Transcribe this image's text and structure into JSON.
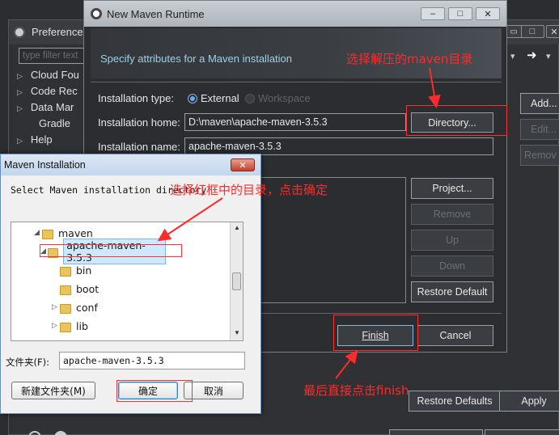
{
  "preferences": {
    "title": "Preferences",
    "filter_placeholder": "type filter text",
    "tree_items": [
      "Cloud Fou",
      "Code Rec",
      "Data Mar",
      "Gradle",
      "Help"
    ],
    "right_buttons": [
      "Add...",
      "Edit...",
      "Remov"
    ],
    "restore_defaults": "Restore Defaults",
    "apply": "Apply"
  },
  "runtime_dialog": {
    "title": "New Maven Runtime",
    "subtitle": "Specify attributes for a Maven installation",
    "installation_type_label": "Installation type:",
    "type_external": "External",
    "type_workspace": "Workspace",
    "installation_home_label": "Installation home:",
    "installation_home_value": "D:\\maven\\apache-maven-3.5.3",
    "directory_button": "Directory...",
    "installation_name_label": "Installation name:",
    "installation_name_value": "apache-maven-3.5.3",
    "side_buttons": {
      "project": "Project...",
      "remove": "Remove",
      "up": "Up",
      "down": "Down",
      "restore_default": "Restore Default"
    },
    "finish": "Finish",
    "cancel": "Cancel"
  },
  "maven_install_dialog": {
    "title": "Maven Installation",
    "prompt": "Select Maven installation directory",
    "tree": {
      "root": "maven",
      "selected": "apache-maven-3.5.3",
      "children": [
        "bin",
        "boot",
        "conf",
        "lib"
      ]
    },
    "folder_label": "文件夹(F):",
    "folder_value": "apache-maven-3.5.3",
    "new_folder": "新建文件夹(M)",
    "ok": "确定",
    "cancel": "取消"
  },
  "annotations": {
    "select_dir": "选择解压的maven目录",
    "select_red_box": "选择红框中的目录，点击确定",
    "finish_note": "最后直接点击finish"
  },
  "colors": {
    "annotation": "#ff2a2a",
    "dialog_bg": "#2b2d30",
    "header_bg": "#3a3d41",
    "selection": "#cde8ff"
  }
}
